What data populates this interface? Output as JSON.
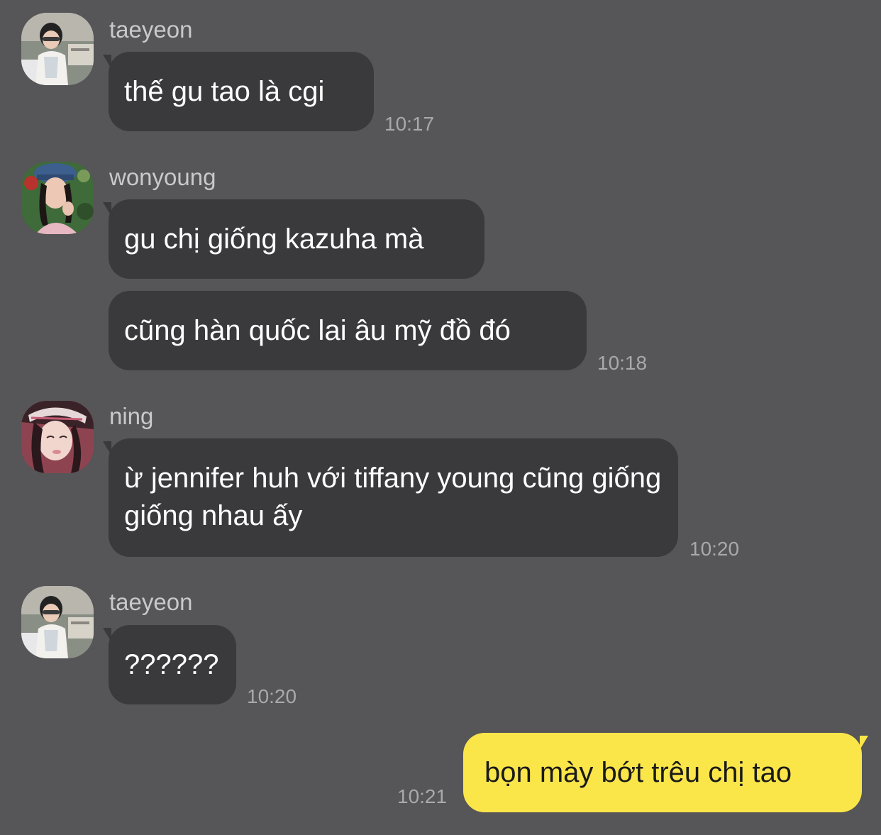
{
  "colors": {
    "background": "#565557",
    "incoming_bubble": "#3a393b",
    "outgoing_bubble": "#fbe64a",
    "sender_name": "#c9c8ca",
    "timestamp": "#a9a8aa"
  },
  "messages": [
    {
      "sender": "taeyeon",
      "text": "thế gu tao là cgi",
      "time": "10:17"
    },
    {
      "sender": "wonyoung",
      "text": "gu chị giống kazuha mà"
    },
    {
      "text": "cũng hàn quốc lai âu mỹ đồ đó",
      "time": "10:18"
    },
    {
      "sender": "ning",
      "text": "ừ jennifer huh với tiffany young cũng giống giống nhau ấy",
      "time": "10:20"
    },
    {
      "sender": "taeyeon",
      "text": "??????",
      "time": "10:20"
    },
    {
      "text": "bọn mày bớt trêu chị tao",
      "time": "10:21",
      "outgoing": true
    }
  ]
}
